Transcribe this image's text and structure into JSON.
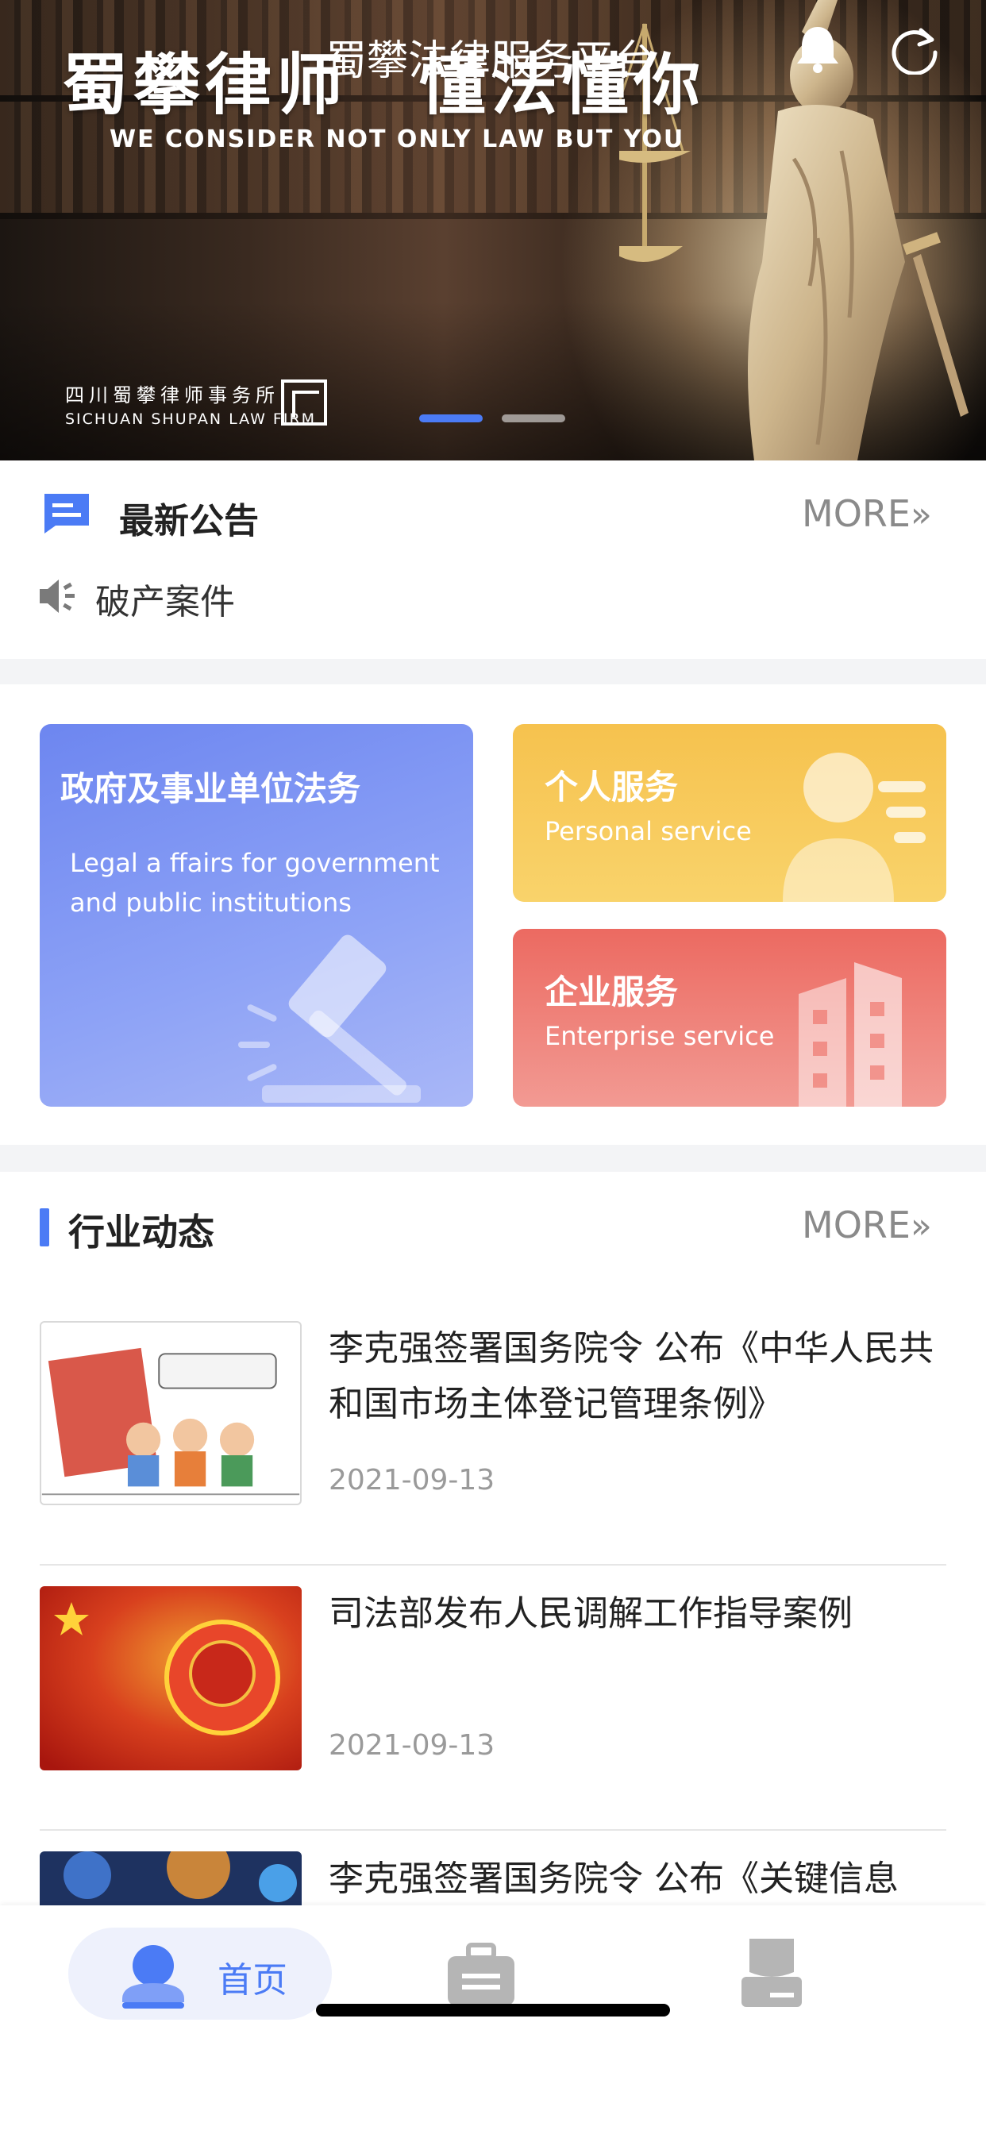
{
  "header": {
    "title": "蜀攀法律服务平台",
    "bell_icon": "bell-icon",
    "refresh_icon": "refresh-icon"
  },
  "banner": {
    "slogan_left": "蜀攀律师",
    "slogan_right": "懂法懂你",
    "subtitle": "WE CONSIDER NOT ONLY LAW BUT YOU",
    "firm_cn": "四川蜀攀律师事务所",
    "firm_en": "SICHUAN SHUPAN LAW FIRM",
    "slides": 2,
    "active_slide": 1
  },
  "notice": {
    "title": "最新公告",
    "more": "MORE",
    "more_chevron": "»",
    "item": "破产案件"
  },
  "services": {
    "government": {
      "title": "政府及事业单位法务",
      "subtitle": "Legal a ffairs for government and public institutions"
    },
    "personal": {
      "title": "个人服务",
      "subtitle": "Personal service"
    },
    "enterprise": {
      "title": "企业服务",
      "subtitle": "Enterprise service"
    }
  },
  "news": {
    "title": "行业动态",
    "more": "MORE",
    "more_chevron": "»",
    "items": [
      {
        "headline": "李克强签署国务院令 公布《中华人民共和国市场主体登记管理条例》",
        "date": "2021-09-13"
      },
      {
        "headline": "司法部发布人民调解工作指导案例",
        "date": "2021-09-13"
      },
      {
        "headline": "李克强签署国务院令 公布《关键信息",
        "date": ""
      }
    ]
  },
  "tabbar": {
    "home_label": "首页"
  },
  "colors": {
    "accent": "#4b7bf5",
    "government_card": "#7a90f3",
    "personal_card": "#f7c95a",
    "enterprise_card": "#ee7e76"
  }
}
